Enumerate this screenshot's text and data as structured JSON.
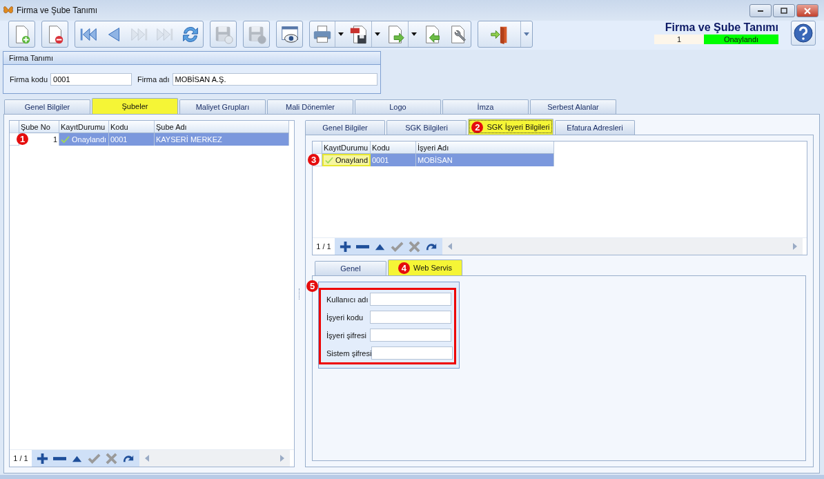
{
  "window": {
    "title": "Firma ve Şube Tanımı"
  },
  "toolbar": [
    {
      "buttons": [
        {
          "kind": "new",
          "disabled": false,
          "dropdown": false
        }
      ]
    },
    {
      "buttons": [
        {
          "kind": "delete",
          "disabled": false,
          "dropdown": false
        }
      ]
    },
    {
      "buttons": [
        {
          "kind": "first",
          "disabled": false,
          "dropdown": false
        },
        {
          "kind": "prev",
          "disabled": false,
          "dropdown": false
        },
        {
          "kind": "next",
          "disabled": true,
          "dropdown": false
        },
        {
          "kind": "last",
          "disabled": true,
          "dropdown": false
        },
        {
          "kind": "refresh",
          "disabled": false,
          "dropdown": false
        }
      ]
    },
    {
      "buttons": [
        {
          "kind": "save",
          "disabled": true,
          "dropdown": false
        }
      ]
    },
    {
      "buttons": [
        {
          "kind": "discard",
          "disabled": true,
          "dropdown": false
        }
      ]
    },
    {
      "buttons": [
        {
          "kind": "preview",
          "disabled": false,
          "dropdown": false
        }
      ]
    },
    {
      "buttons": [
        {
          "kind": "print",
          "disabled": false,
          "dropdown": true
        },
        {
          "kind": "pdf",
          "disabled": false,
          "dropdown": true
        },
        {
          "kind": "export",
          "disabled": false,
          "dropdown": true
        },
        {
          "kind": "import",
          "disabled": false,
          "dropdown": false
        },
        {
          "kind": "tools",
          "disabled": false,
          "dropdown": false
        }
      ]
    },
    {
      "buttons": [
        {
          "kind": "exit",
          "disabled": false,
          "dropdown": true
        }
      ]
    }
  ],
  "header": {
    "title": "Firma ve Şube Tanımı",
    "record": "1",
    "status": "Onaylandı"
  },
  "firm": {
    "title": "Firma Tanımı",
    "fields": [
      {
        "label": "Firma kodu",
        "value": "0001"
      },
      {
        "label": "Firma adı",
        "value": "MOBİSAN A.Ş."
      }
    ]
  },
  "main_tabs": [
    {
      "label": "Genel Bilgiler",
      "selected": false
    },
    {
      "label": "Şubeler",
      "selected": true
    },
    {
      "label": "Maliyet Grupları",
      "selected": false
    },
    {
      "label": "Mali Dönemler",
      "selected": false
    },
    {
      "label": "Logo",
      "selected": false
    },
    {
      "label": "İmza",
      "selected": false
    },
    {
      "label": "Serbest Alanlar",
      "selected": false
    }
  ],
  "branches": {
    "columns": [
      "Şube No",
      "KayıtDurumu",
      "Kodu",
      "Şube Adı"
    ],
    "rows": [
      {
        "selected": true,
        "callout": "1",
        "cells": [
          "1",
          "Onaylandı",
          "0001",
          "KAYSERİ MERKEZ"
        ]
      }
    ],
    "pager": "1 / 1"
  },
  "navigator": [
    {
      "kind": "add",
      "disabled": false
    },
    {
      "kind": "remove",
      "disabled": false
    },
    {
      "kind": "up",
      "disabled": false
    },
    {
      "kind": "confirm",
      "disabled": true
    },
    {
      "kind": "cancel",
      "disabled": true
    },
    {
      "kind": "redo",
      "disabled": false
    }
  ],
  "sub_tabs": [
    {
      "label": "Genel Bilgiler",
      "selected": false
    },
    {
      "label": "SGK Bilgileri",
      "selected": false
    },
    {
      "label": "SGK İşyeri Bilgileri",
      "selected": true,
      "callout": "2"
    },
    {
      "label": "Efatura Adresleri",
      "selected": false
    }
  ],
  "workplaces": {
    "columns": [
      "KayıtDurumu",
      "Kodu",
      "İşyeri Adı"
    ],
    "rows": [
      {
        "selected": true,
        "callout": "3",
        "cells": [
          {
            "text": "Onayland",
            "highlighted": true
          },
          {
            "text": "0001",
            "highlighted": false
          },
          {
            "text": "MOBİSAN",
            "highlighted": false
          }
        ]
      }
    ],
    "pager": "1 / 1"
  },
  "inner_tabs": [
    {
      "label": "Genel",
      "selected": false
    },
    {
      "label": "Web Servis",
      "selected": true,
      "callout": "4"
    }
  ],
  "web_service": {
    "callout": "5",
    "highlighted": true,
    "fields": [
      {
        "label": "Kullanıcı adı"
      },
      {
        "label": "İşyeri kodu"
      },
      {
        "label": "İşyeri şifresi"
      },
      {
        "label": "Sistem şifresi"
      }
    ]
  }
}
